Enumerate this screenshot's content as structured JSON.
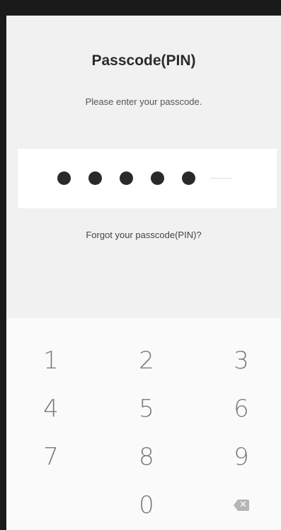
{
  "header": {
    "title": "Passcode(PIN)",
    "subtitle": "Please enter your passcode."
  },
  "pin": {
    "entered_count": 5
  },
  "links": {
    "forgot": "Forgot your passcode(PIN)?"
  },
  "keypad": {
    "keys": [
      "1",
      "2",
      "3",
      "4",
      "5",
      "6",
      "7",
      "8",
      "9",
      "0"
    ],
    "backspace_icon": "backspace-icon"
  }
}
